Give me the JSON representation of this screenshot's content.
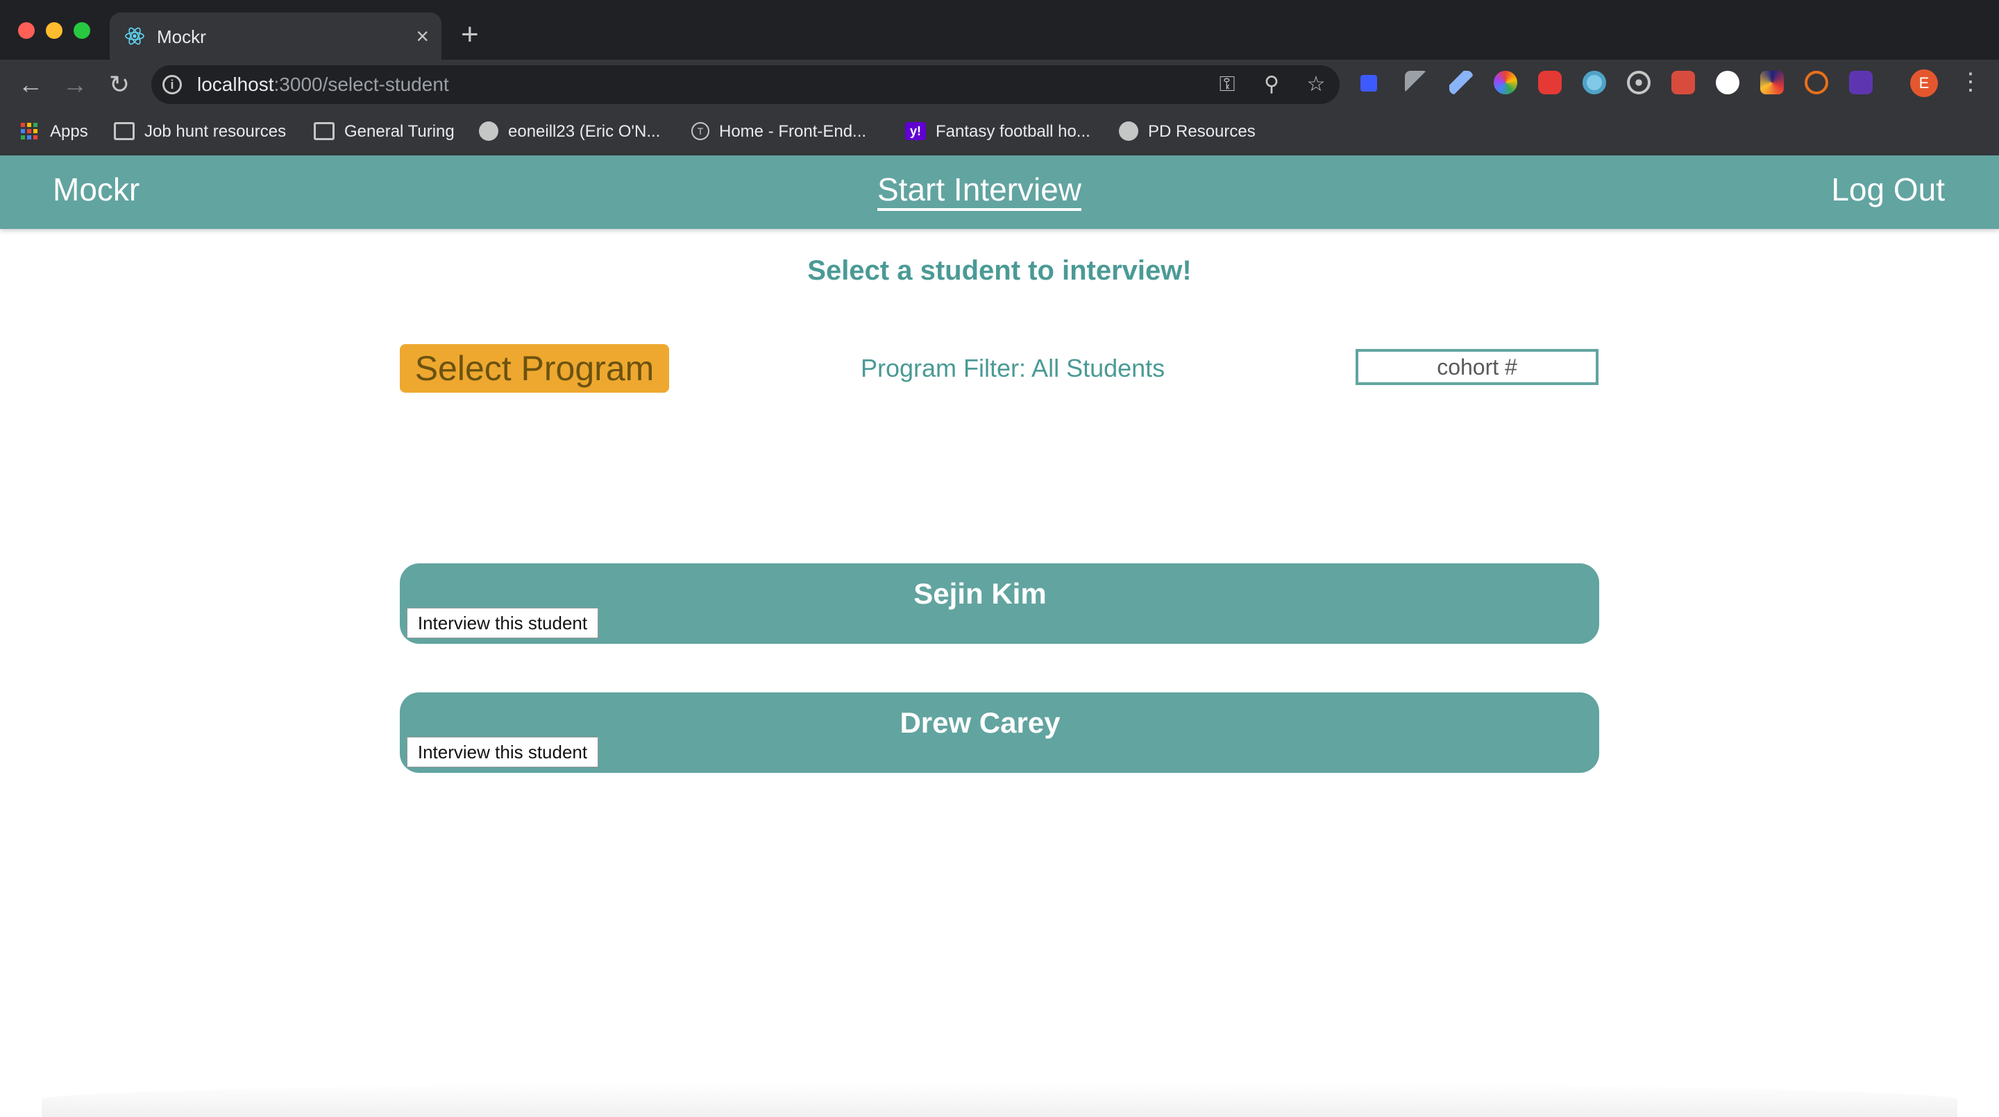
{
  "browser": {
    "tab_title": "Mockr",
    "tab_close": "×",
    "new_tab": "+",
    "url_host": "localhost",
    "url_rest": ":3000/select-student",
    "avatar_letter": "E",
    "bookmarks": [
      {
        "label": "Apps",
        "icon": "apps-grid-icon"
      },
      {
        "label": "Job hunt resources",
        "icon": "folder-icon"
      },
      {
        "label": "General Turing",
        "icon": "folder-icon"
      },
      {
        "label": "eoneill23 (Eric O'N...",
        "icon": "github-icon"
      },
      {
        "label": "Home - Front-End...",
        "icon": "turing-icon"
      },
      {
        "label": "Fantasy football ho...",
        "icon": "yahoo-icon"
      },
      {
        "label": "PD Resources",
        "icon": "github-icon"
      }
    ]
  },
  "header": {
    "brand": "Mockr",
    "nav_start": "Start Interview",
    "logout": "Log Out",
    "color": "#62a4a0"
  },
  "main": {
    "heading": "Select a student to interview!",
    "select_program_label": "Select Program",
    "filter_label": "Program Filter: All Students",
    "cohort_placeholder": "cohort #",
    "accent_color": "#eea82f",
    "students": [
      {
        "name": "Sejin Kim",
        "button_label": "Interview this student"
      },
      {
        "name": "Drew Carey",
        "button_label": "Interview this student"
      }
    ]
  }
}
